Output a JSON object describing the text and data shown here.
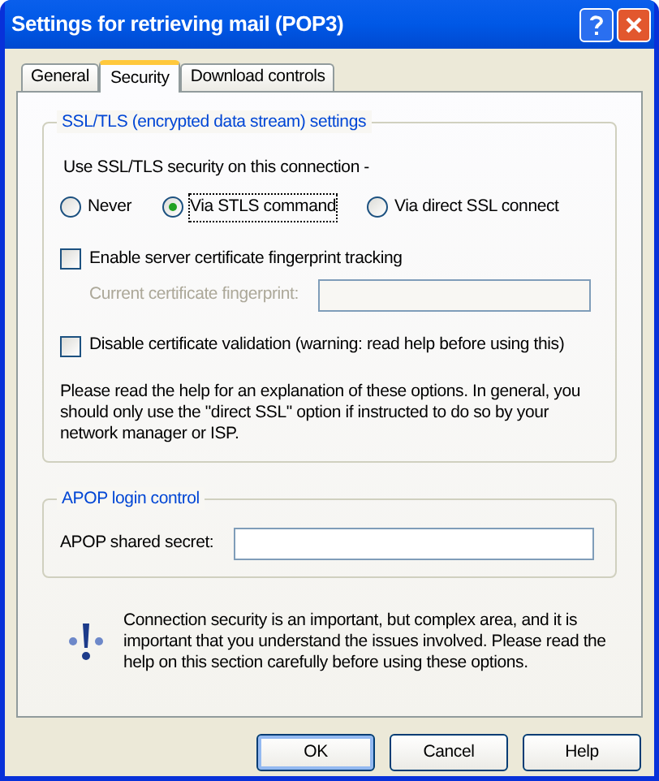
{
  "window": {
    "title": "Settings for retrieving mail (POP3)"
  },
  "tabs": [
    {
      "label": "General",
      "selected": false
    },
    {
      "label": "Security",
      "selected": true
    },
    {
      "label": "Download controls",
      "selected": false
    }
  ],
  "ssl_group": {
    "title": "SSL/TLS (encrypted data stream) settings",
    "prompt": "Use SSL/TLS security on this connection -",
    "radios": [
      {
        "label": "Never",
        "selected": false
      },
      {
        "label": "Via STLS command",
        "selected": true
      },
      {
        "label": "Via direct SSL connect",
        "selected": false
      }
    ],
    "fingerprint_checkbox": {
      "label": "Enable server certificate fingerprint tracking",
      "checked": false
    },
    "fingerprint_field": {
      "label": "Current certificate fingerprint:",
      "disabled": true
    },
    "validation_checkbox": {
      "label": "Disable certificate validation (warning: read help before using this)",
      "checked": false
    },
    "note": "Please read the help for an explanation of these options. In general, you should only use the \"direct SSL\" option if instructed to do so by your network manager or ISP."
  },
  "apop_group": {
    "title": "APOP login control",
    "field": {
      "label": "APOP shared secret:"
    }
  },
  "warning": "Connection security is an important, but complex area, and it is important that you understand the issues involved. Please read the help on this section carefully before using these options.",
  "buttons": [
    "OK",
    "Cancel",
    "Help"
  ]
}
